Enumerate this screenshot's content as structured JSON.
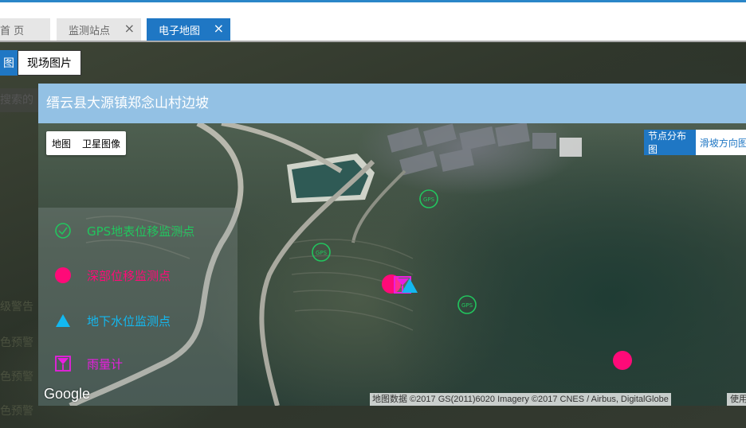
{
  "tabs": [
    {
      "label": "首 页",
      "active": false
    },
    {
      "label": "监测站点",
      "active": false
    },
    {
      "label": "电子地图",
      "active": true
    }
  ],
  "tab_close_glyph": "×",
  "subtabs": {
    "left": "图",
    "right": "现场图片"
  },
  "left_stub": {
    "search_fragment": "搜索的",
    "warn_fragment": "级警告",
    "color_rows": [
      "色预警",
      "色预警",
      "色预警"
    ]
  },
  "dialog": {
    "title": "缙云县大源镇郑念山村边坡",
    "map_type": {
      "map": "地图",
      "satellite": "卫星图像"
    },
    "view_tabs": {
      "node_distribution": "节点分布图",
      "slide_direction": "滑坡方向图"
    },
    "legend": [
      {
        "label": "GPS地表位移监测点",
        "color": "#22c55e",
        "icon": "gps-circle-icon"
      },
      {
        "label": "深部位移监测点",
        "color": "#ff0a78",
        "icon": "magenta-dot-icon"
      },
      {
        "label": "地下水位监测点",
        "color": "#13b8f0",
        "icon": "blue-triangle-icon"
      },
      {
        "label": "雨量计",
        "color": "#e91ee0",
        "icon": "rain-gauge-icon"
      }
    ],
    "marker_gps_text": "GPS",
    "google": "Google",
    "attribution": "地图数据 ©2017 GS(2011)6020 Imagery ©2017 CNES / Airbus, DigitalGlobe",
    "terms": "使用"
  }
}
